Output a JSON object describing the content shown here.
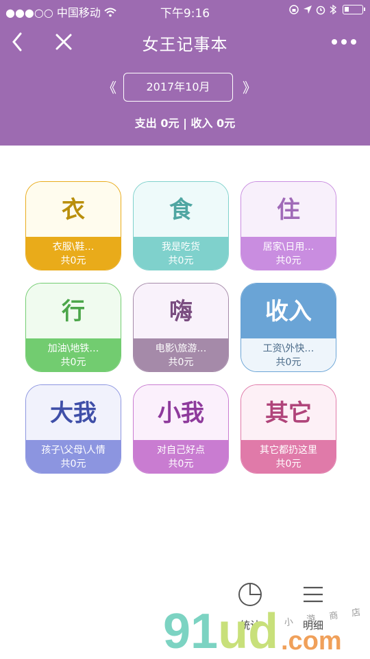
{
  "status_bar": {
    "signal": "●●●○○",
    "carrier": "中国移动",
    "time": "下午9:16"
  },
  "nav": {
    "title": "女王记事本"
  },
  "month": {
    "prev": "《",
    "label": "2017年10月",
    "next": "》"
  },
  "summary": {
    "text": "支出 0元 | 收入 0元"
  },
  "categories": [
    {
      "title": "衣",
      "sub": "衣服\\鞋…",
      "amount": "共0元"
    },
    {
      "title": "食",
      "sub": "我是吃货",
      "amount": "共0元"
    },
    {
      "title": "住",
      "sub": "居家\\日用…",
      "amount": "共0元"
    },
    {
      "title": "行",
      "sub": "加油\\地铁…",
      "amount": "共0元"
    },
    {
      "title": "嗨",
      "sub": "电影\\旅游…",
      "amount": "共0元"
    },
    {
      "title": "收入",
      "sub": "工资\\外快…",
      "amount": "共0元"
    },
    {
      "title": "大我",
      "sub": "孩子\\父母\\人情",
      "amount": "共0元"
    },
    {
      "title": "小我",
      "sub": "对自己好点",
      "amount": "共0元"
    },
    {
      "title": "其它",
      "sub": "其它都扔这里",
      "amount": "共0元"
    }
  ],
  "bottom_nav": {
    "stats_label": "统计",
    "detail_label": "明细"
  },
  "watermark": {
    "big": "91ud",
    "dotcom": ".com",
    "small": "小  游  商  店"
  },
  "colors": {
    "header": "#9d6bb1",
    "cat_yi": "#e9ab1a",
    "cat_shi": "#7fd1cc",
    "cat_zhu": "#c98de0",
    "cat_xing": "#72cc70",
    "cat_hai": "#a58aa9",
    "cat_shouru": "#6aa4d6",
    "cat_dawo": "#8c95e0",
    "cat_xiaowo": "#c97cd1",
    "cat_qita": "#e07aa9"
  },
  "icons": [
    "chevron-left-icon",
    "close-icon",
    "more-dots-icon",
    "wifi-icon",
    "lock-rotation-icon",
    "location-arrow-icon",
    "alarm-icon",
    "bluetooth-icon",
    "battery-icon",
    "pie-chart-icon",
    "list-icon"
  ]
}
